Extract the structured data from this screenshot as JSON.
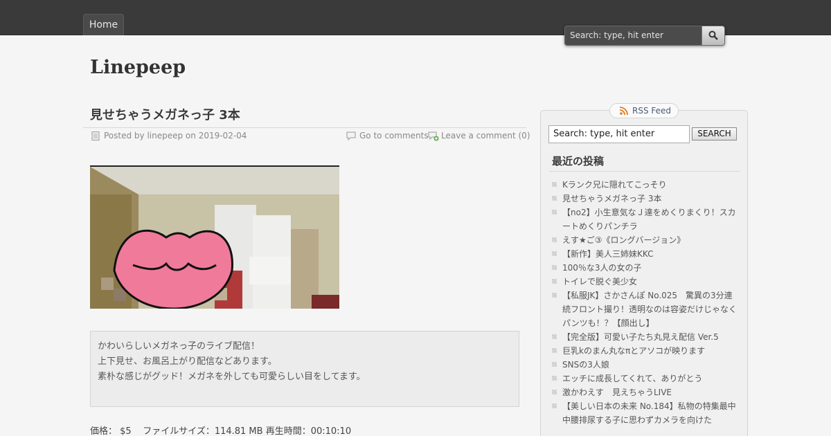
{
  "nav": {
    "home_label": "Home"
  },
  "top_search": {
    "placeholder": "Search: type, hit enter"
  },
  "site": {
    "title": "Linepeep"
  },
  "post": {
    "title": "見せちゃうメガネっ子 3本",
    "meta_posted": "Posted by linepeep on 2019-02-04",
    "meta_goto": "Go to comments",
    "meta_leave": "Leave a comment (0)",
    "description_lines": [
      "かわいらしいメガネっ子のライブ配信！",
      "上下見せ、お風呂上がり配信などあります。",
      "素朴な感じがグッド！メガネを外しても可愛らしい目をしてます。"
    ],
    "price_line": "価格： $5    ファイルサイズ：114.81 MB 再生時間：00:10:10"
  },
  "sidebar": {
    "rss_label": "RSS Feed",
    "search_value": "Search: type, hit enter",
    "search_button": "SEARCH",
    "recent_title": "最近の投稿",
    "recent_posts": [
      "Kランク兄に隠れてこっそり",
      "見せちゃうメガネっ子 3本",
      "【no2】小生意気なＪ達をめくりまくり！スカートめくりパンチラ",
      "えす★ご③《ロングバージョン》",
      "【新作】美人三姉妹KKC",
      "100％な3人の女の子",
      "トイレで脱ぐ美少女",
      "【私服JK】さかさんぽ No.025　驚異の3分連続フロント撮り！透明なのは容姿だけじゃなくパンツも！？【顔出し】",
      "【完全版】可愛い子たち丸見え配信 Ver.5",
      "巨乳kのまん丸なπとアソコが映ります",
      "SNSの3人娘",
      "エッチに成長してくれて、ありがとう",
      "激かわえす　見えちゃうLIVE",
      "【美しい日本の未来 No.184】私物の特集最中　中腰排尿する子に思わずカメラを向けた"
    ]
  },
  "colors": {
    "topbar": "#3a3a3a",
    "background": "#f5f5f5",
    "lips": "#f07a9a"
  }
}
